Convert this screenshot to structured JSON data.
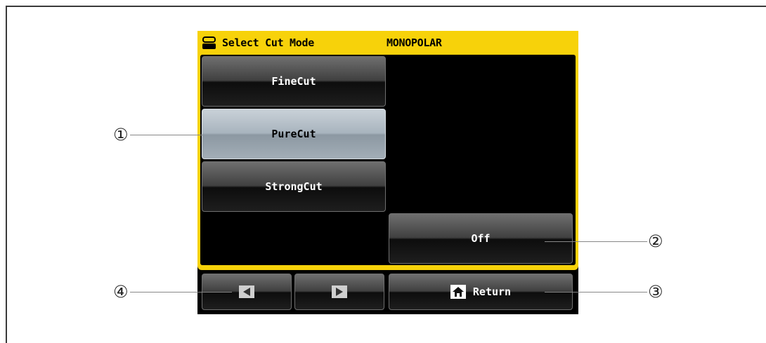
{
  "header": {
    "title": "Select Cut Mode",
    "mode": "MONOPOLAR"
  },
  "modes": {
    "fine": "FineCut",
    "pure": "PureCut",
    "strong": "StrongCut",
    "off": "Off"
  },
  "nav": {
    "return_label": "Return"
  },
  "callouts": {
    "c1": "①",
    "c2": "②",
    "c3": "③",
    "c4": "④"
  },
  "colors": {
    "panel": "#f7d20a",
    "selected": "#a8b4be"
  },
  "icons": {
    "header": "device-icon",
    "prev": "triangle-left-icon",
    "next": "triangle-right-icon",
    "home": "home-icon"
  }
}
